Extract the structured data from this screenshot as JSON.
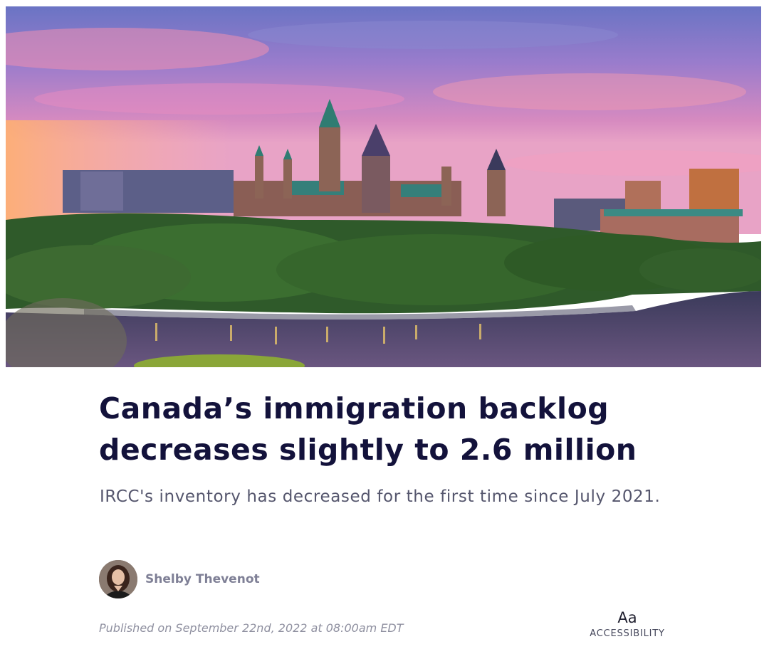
{
  "article": {
    "title_line1": "Canada’s immigration backlog",
    "title_line2": "decreases slightly to 2.6 million",
    "subtitle": "IRCC's inventory has decreased for the first time since July 2021.",
    "published": "Published on September 22nd, 2022 at 08:00am EDT"
  },
  "author": {
    "name": "Shelby Thevenot"
  },
  "accessibility": {
    "icon_text": "Aa",
    "label": "ACCESSIBILITY"
  },
  "colors": {
    "title": "#13123b",
    "subtitle": "#55566d",
    "author": "#7f8096",
    "meta": "#8f90a0"
  },
  "icons": {
    "hero": "parliament-hill-photo",
    "avatar": "author-avatar"
  }
}
